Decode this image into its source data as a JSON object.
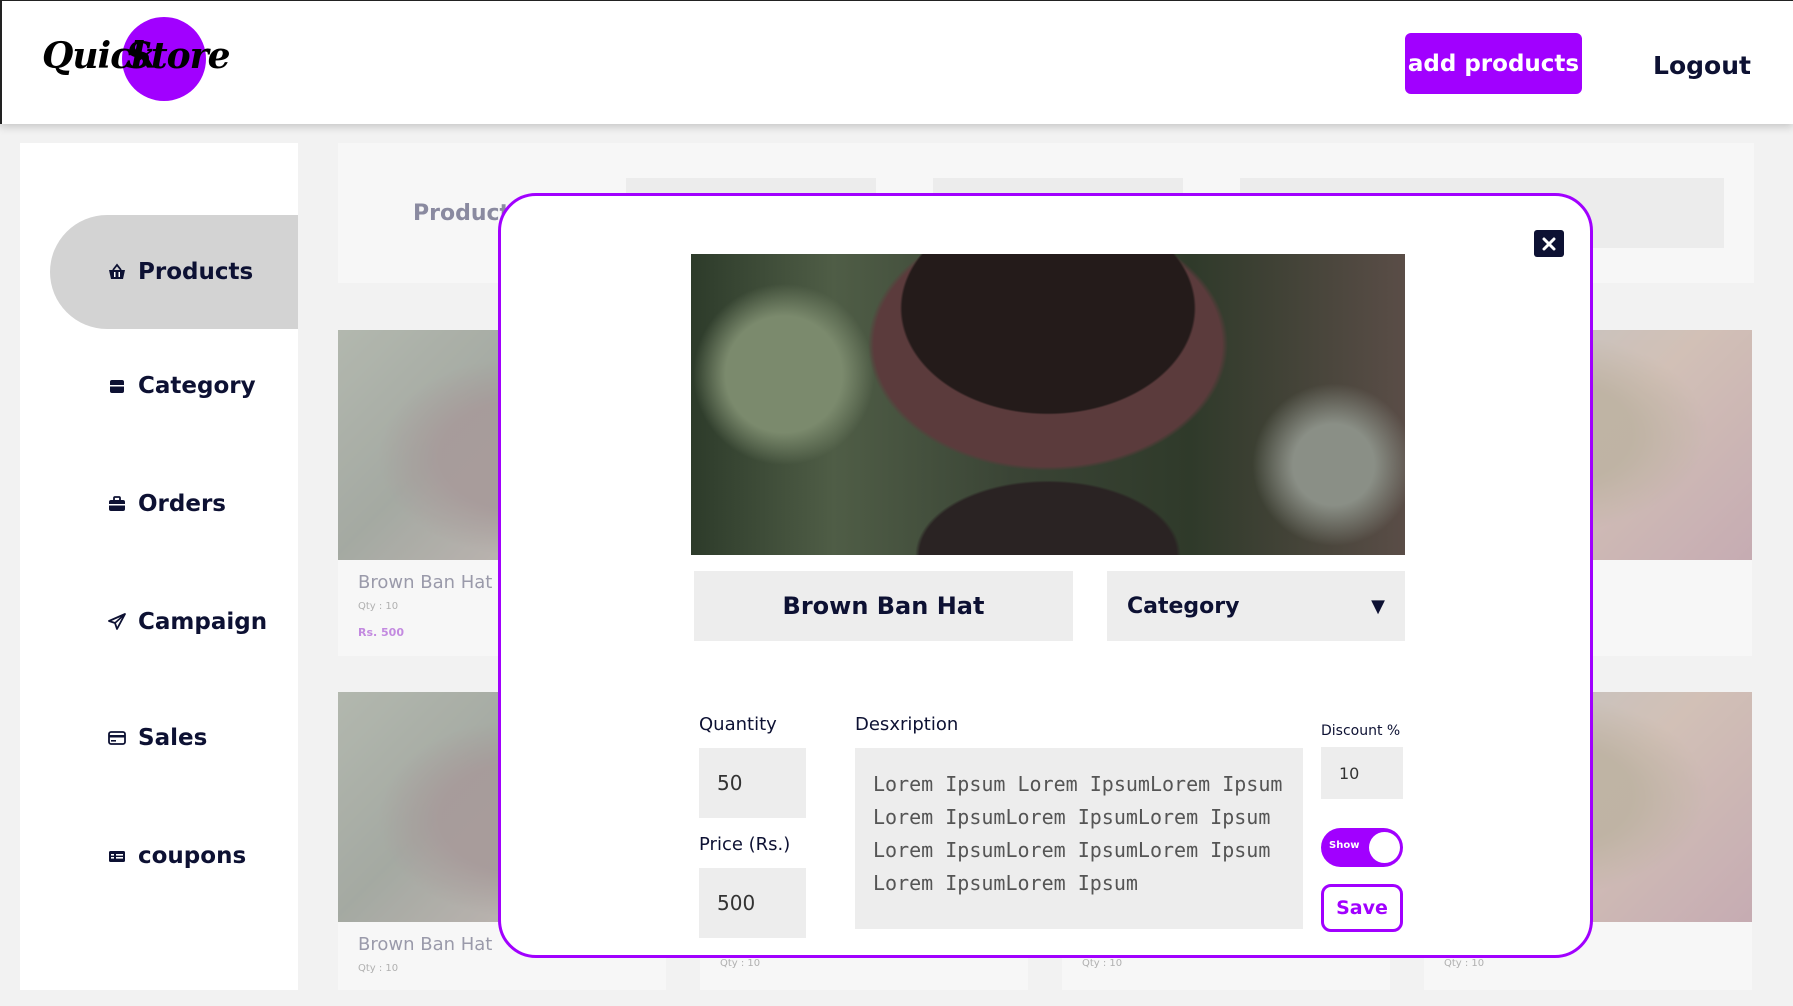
{
  "header": {
    "logo_word1": "Quick",
    "logo_word2": "Store",
    "add_products_label": "add products",
    "logout_label": "Logout"
  },
  "sidebar": {
    "items": [
      {
        "label": "Products",
        "icon": "basket-icon",
        "active": true
      },
      {
        "label": "Category",
        "icon": "box-icon",
        "active": false
      },
      {
        "label": "Orders",
        "icon": "briefcase-icon",
        "active": false
      },
      {
        "label": "Campaign",
        "icon": "paper-plane-icon",
        "active": false
      },
      {
        "label": "Sales",
        "icon": "credit-card-icon",
        "active": false
      },
      {
        "label": "coupons",
        "icon": "money-bill-icon",
        "active": false
      }
    ]
  },
  "filter_bar": {
    "label": "Product"
  },
  "cards": [
    {
      "title": "Brown Ban Hat",
      "qty": "Qty : 10",
      "price": "Rs. 500"
    },
    {
      "title": "Brown Ban Hat",
      "qty": "Qty : 10"
    },
    {
      "qty": "Qty : 10"
    },
    {
      "qty": "Qty : 10"
    },
    {
      "qty": "Qty : 10"
    }
  ],
  "modal": {
    "product_name": "Brown Ban Hat",
    "category_value": "Category",
    "caret": "▼",
    "quantity_label": "Quantity",
    "quantity_value": "50",
    "price_label": "Price  (Rs.)",
    "price_value": "500",
    "description_label": "Desxription",
    "description_value": "Lorem Ipsum Lorem IpsumLorem Ipsum Lorem IpsumLorem IpsumLorem Ipsum Lorem IpsumLorem IpsumLorem Ipsum Lorem IpsumLorem Ipsum",
    "discount_label": "Discount %",
    "discount_value": "10",
    "toggle_label": "Show",
    "toggle_on": true,
    "save_label": "Save"
  },
  "colors": {
    "accent": "#a100ff",
    "text_dark": "#0d1133",
    "field_bg": "#ededed",
    "page_bg": "#f2f2f2"
  }
}
